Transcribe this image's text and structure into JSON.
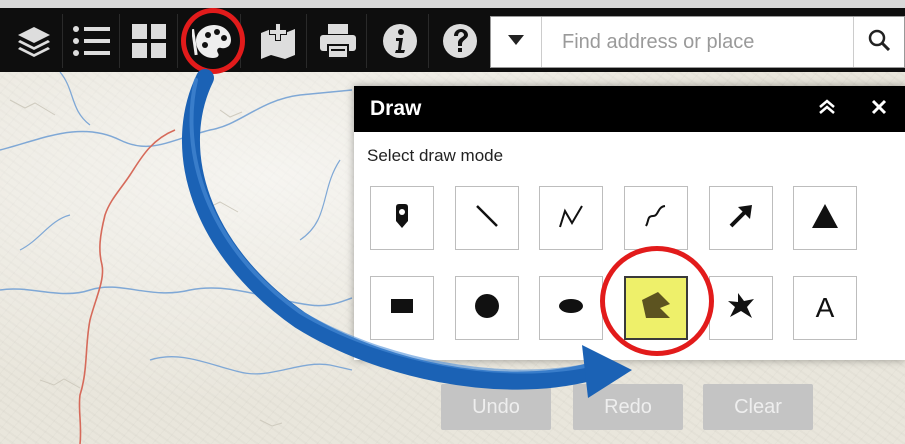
{
  "toolbar": {
    "buttons": [
      {
        "name": "layers-button",
        "icon": "layers-icon"
      },
      {
        "name": "legend-button",
        "icon": "list-icon"
      },
      {
        "name": "basemap-button",
        "icon": "grid-icon"
      },
      {
        "name": "draw-button",
        "icon": "palette-icon"
      },
      {
        "name": "add-data-button",
        "icon": "add-map-icon"
      },
      {
        "name": "print-button",
        "icon": "printer-icon"
      },
      {
        "name": "about-button",
        "icon": "info-icon"
      },
      {
        "name": "help-button",
        "icon": "help-icon"
      }
    ]
  },
  "search": {
    "placeholder": "Find address or place",
    "icon": "search-icon",
    "dropdown_icon": "caret-down-icon"
  },
  "draw_panel": {
    "title": "Draw",
    "subtitle": "Select draw mode",
    "collapse_icon": "chevrons-up-icon",
    "close_icon": "close-icon",
    "tools": [
      {
        "name": "point",
        "icon": "pin-icon"
      },
      {
        "name": "line",
        "icon": "line-icon"
      },
      {
        "name": "polyline",
        "icon": "polyline-icon"
      },
      {
        "name": "freehand-line",
        "icon": "freehand-line-icon"
      },
      {
        "name": "arrow",
        "icon": "arrow-icon"
      },
      {
        "name": "triangle",
        "icon": "triangle-icon"
      },
      {
        "name": "rectangle",
        "icon": "rectangle-icon"
      },
      {
        "name": "circle",
        "icon": "circle-icon"
      },
      {
        "name": "ellipse",
        "icon": "ellipse-icon"
      },
      {
        "name": "polygon",
        "icon": "polygon-icon",
        "active": true
      },
      {
        "name": "freehand-polygon",
        "icon": "freehand-polygon-icon"
      },
      {
        "name": "text",
        "icon": "text-icon",
        "label": "A"
      }
    ]
  },
  "actions": {
    "undo": "Undo",
    "redo": "Redo",
    "clear": "Clear"
  },
  "colors": {
    "toolbar_bg": "#0e0e0e",
    "highlight_ring": "#e21b1b",
    "arrow_blue": "#1b62b5",
    "active_tool_bg": "#eef06a"
  }
}
